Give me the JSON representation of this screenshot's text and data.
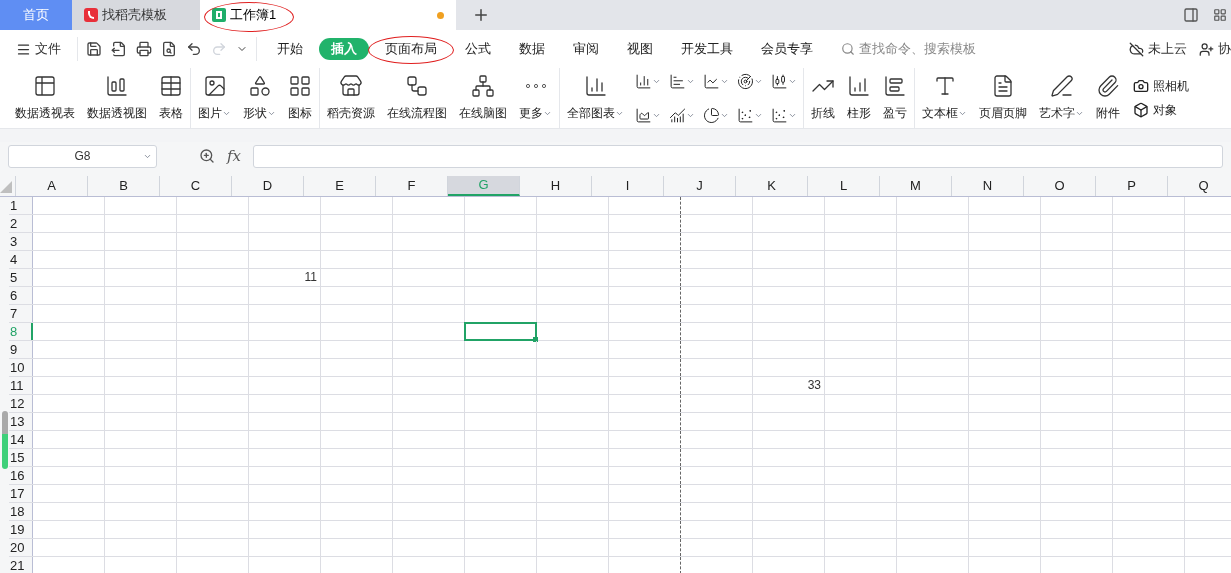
{
  "doc_tabs": [
    {
      "label": "首页",
      "kind": "home",
      "selected": false,
      "unsaved": false
    },
    {
      "label": "找稻壳模板",
      "kind": "docer",
      "selected": false,
      "unsaved": false
    },
    {
      "label": "工作簿1",
      "kind": "sheet",
      "selected": true,
      "unsaved": true
    }
  ],
  "menu": {
    "file_label": "文件",
    "ribbon_tabs": [
      {
        "label": "开始",
        "selected": false
      },
      {
        "label": "插入",
        "selected": true
      },
      {
        "label": "页面布局",
        "selected": false
      },
      {
        "label": "公式",
        "selected": false
      },
      {
        "label": "数据",
        "selected": false
      },
      {
        "label": "审阅",
        "selected": false
      },
      {
        "label": "视图",
        "selected": false
      },
      {
        "label": "开发工具",
        "selected": false
      },
      {
        "label": "会员专享",
        "selected": false
      }
    ],
    "search": {
      "placeholder": "查找命令、搜索模板"
    },
    "cloud_label": "未上云",
    "share_label": "协"
  },
  "ribbon": [
    {
      "kind": "large",
      "items": [
        {
          "label": "数据透视表",
          "dropdown": false
        },
        {
          "label": "数据透视图",
          "dropdown": false
        },
        {
          "label": "表格",
          "dropdown": false
        }
      ]
    },
    {
      "kind": "large",
      "items": [
        {
          "label": "图片",
          "dropdown": true
        },
        {
          "label": "形状",
          "dropdown": true
        },
        {
          "label": "图标",
          "dropdown": false
        }
      ]
    },
    {
      "kind": "large",
      "items": [
        {
          "label": "稻壳资源",
          "dropdown": false
        },
        {
          "label": "在线流程图",
          "dropdown": false
        },
        {
          "label": "在线脑图",
          "dropdown": false
        },
        {
          "label": "更多",
          "dropdown": true
        }
      ]
    },
    {
      "kind": "charts",
      "items": [
        {
          "label": "全部图表",
          "dropdown": true
        }
      ]
    },
    {
      "kind": "large",
      "items": [
        {
          "label": "折线",
          "dropdown": false
        },
        {
          "label": "柱形",
          "dropdown": false
        },
        {
          "label": "盈亏",
          "dropdown": false
        }
      ]
    },
    {
      "kind": "large",
      "items": [
        {
          "label": "文本框",
          "dropdown": true
        },
        {
          "label": "页眉页脚",
          "dropdown": false
        },
        {
          "label": "艺术字",
          "dropdown": true
        },
        {
          "label": "附件",
          "dropdown": false
        }
      ]
    },
    {
      "kind": "stack",
      "items": [
        {
          "label": "照相机",
          "dropdown": false
        },
        {
          "label": "对象",
          "dropdown": false
        }
      ]
    }
  ],
  "formula_bar": {
    "name_box": "G8",
    "fx_label": "fx"
  },
  "sheet": {
    "columns": [
      {
        "label": "A",
        "selected": false
      },
      {
        "label": "B",
        "selected": false
      },
      {
        "label": "C",
        "selected": false
      },
      {
        "label": "D",
        "selected": false
      },
      {
        "label": "E",
        "selected": false
      },
      {
        "label": "F",
        "selected": false
      },
      {
        "label": "G",
        "selected": true
      },
      {
        "label": "H",
        "selected": false
      },
      {
        "label": "I",
        "selected": false
      },
      {
        "label": "J",
        "selected": false
      },
      {
        "label": "K",
        "selected": false
      },
      {
        "label": "L",
        "selected": false
      },
      {
        "label": "M",
        "selected": false
      },
      {
        "label": "N",
        "selected": false
      },
      {
        "label": "O",
        "selected": false
      },
      {
        "label": "P",
        "selected": false
      },
      {
        "label": "Q",
        "selected": false
      }
    ],
    "rows": [
      {
        "label": "1",
        "selected": false
      },
      {
        "label": "2",
        "selected": false
      },
      {
        "label": "3",
        "selected": false
      },
      {
        "label": "4",
        "selected": false
      },
      {
        "label": "5",
        "selected": false,
        "cells": [
          null,
          null,
          null,
          "11"
        ]
      },
      {
        "label": "6",
        "selected": false
      },
      {
        "label": "7",
        "selected": false
      },
      {
        "label": "8",
        "selected": true
      },
      {
        "label": "9",
        "selected": false
      },
      {
        "label": "10",
        "selected": false
      },
      {
        "label": "11",
        "selected": false,
        "cells": [
          null,
          null,
          null,
          null,
          null,
          null,
          null,
          null,
          null,
          null,
          "33"
        ]
      },
      {
        "label": "12",
        "selected": false
      },
      {
        "label": "13",
        "selected": false
      },
      {
        "label": "14",
        "selected": false
      },
      {
        "label": "15",
        "selected": false
      },
      {
        "label": "16",
        "selected": false
      },
      {
        "label": "17",
        "selected": false
      },
      {
        "label": "18",
        "selected": false
      },
      {
        "label": "19",
        "selected": false
      },
      {
        "label": "20",
        "selected": false
      },
      {
        "label": "21",
        "selected": false
      }
    ]
  }
}
